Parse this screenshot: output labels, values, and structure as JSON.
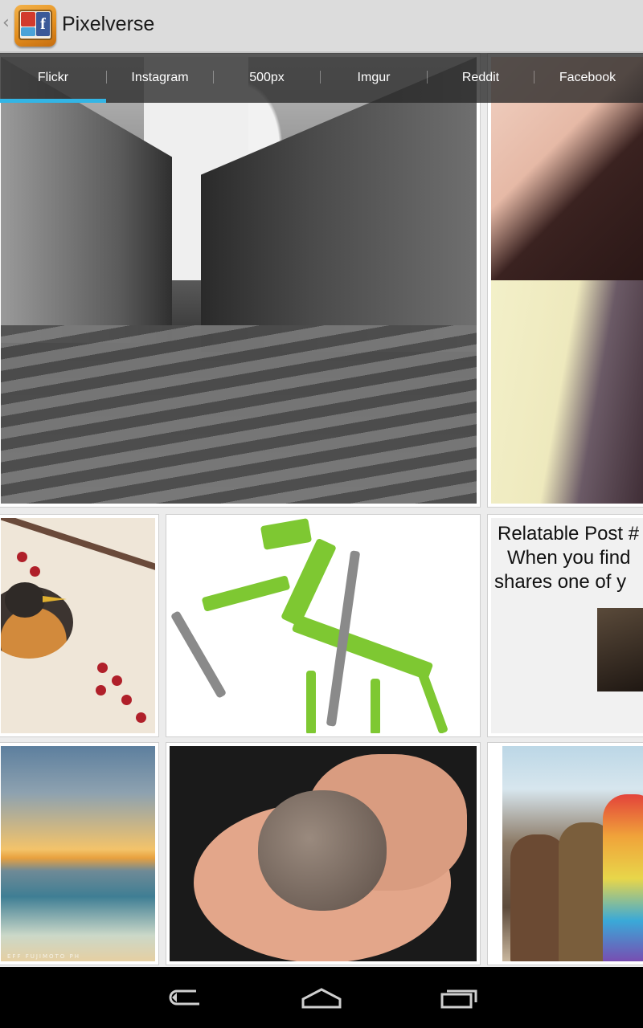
{
  "app": {
    "title": "Pixelverse",
    "icon": "pixelverse-app-icon"
  },
  "tabs": {
    "items": [
      {
        "label": "Flickr",
        "selected": true
      },
      {
        "label": "Instagram",
        "selected": false
      },
      {
        "label": "500px",
        "selected": false
      },
      {
        "label": "Imgur",
        "selected": false
      },
      {
        "label": "Reddit",
        "selected": false
      },
      {
        "label": "Facebook",
        "selected": false
      }
    ],
    "indicator_color": "#33b5e5"
  },
  "grid": {
    "relatable_post": {
      "line1": "Relatable Post #",
      "line2": "When you find",
      "line3": "shares one of y"
    },
    "sunset_watermark": "EFF FUJIMOTO PH"
  },
  "navbar": {
    "back_icon": "back-arrow-icon",
    "home_icon": "home-icon",
    "recents_icon": "recent-apps-icon"
  }
}
